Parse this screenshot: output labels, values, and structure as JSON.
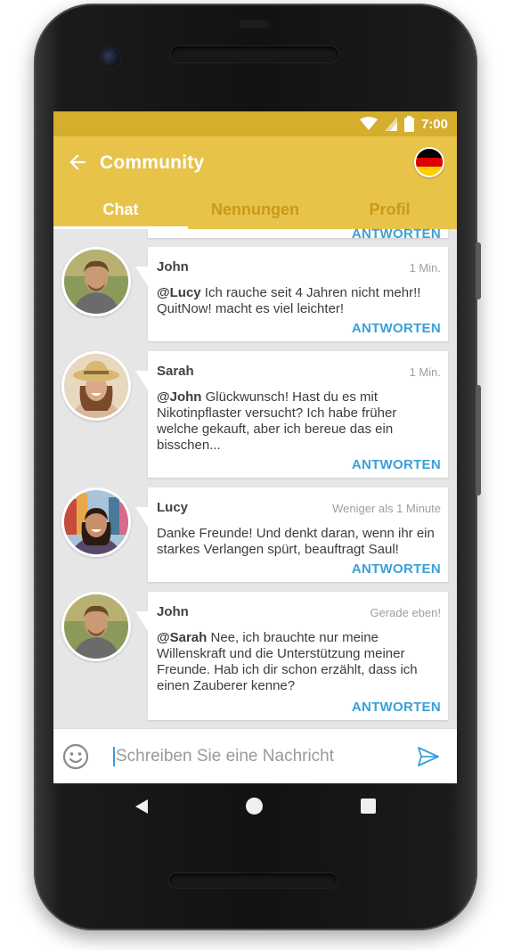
{
  "status_bar": {
    "time": "7:00"
  },
  "app_bar": {
    "title": "Community"
  },
  "tabs": [
    {
      "label": "Chat",
      "active": true
    },
    {
      "label": "Nennungen",
      "active": false
    },
    {
      "label": "Profil",
      "active": false
    }
  ],
  "partial_reply": "ANTWORTEN",
  "messages": [
    {
      "author": "John",
      "time": "1 Min.",
      "mention": "@Lucy",
      "text": " Ich rauche seit 4 Jahren nicht mehr!! QuitNow! macht es viel leichter!",
      "reply_label": "ANTWORTEN"
    },
    {
      "author": "Sarah",
      "time": "1 Min.",
      "mention": "@John",
      "text": " Glückwunsch! Hast du es mit Nikotinpflaster versucht? Ich habe früher welche gekauft, aber ich bereue das ein bisschen...",
      "reply_label": "ANTWORTEN"
    },
    {
      "author": "Lucy",
      "time": "Weniger als 1 Minute",
      "mention": "",
      "text": "Danke Freunde! Und denkt daran, wenn ihr ein starkes Verlangen spürt, beauftragt Saul!",
      "reply_label": "ANTWORTEN"
    },
    {
      "author": "John",
      "time": "Gerade eben!",
      "mention": "@Sarah",
      "text": " Nee, ich brauchte nur meine Willenskraft und die Unterstützung meiner Freunde. Hab ich dir schon erzählt, dass ich einen Zauberer kenne?",
      "reply_label": "ANTWORTEN"
    }
  ],
  "composer": {
    "placeholder": "Schreiben Sie eine Nachricht"
  },
  "colors": {
    "status_bar": "#d4ae2c",
    "app_bar": "#e8c34a",
    "tab_inactive": "#c89a18",
    "reply_link": "#3aa0d8",
    "flag_black": "#000000",
    "flag_red": "#dd0000",
    "flag_gold": "#ffce00"
  },
  "icons": {
    "back": "arrow-left-icon",
    "flag": "germany-flag-icon",
    "emoji": "smiley-icon",
    "send": "send-icon",
    "wifi": "wifi-icon",
    "signal": "signal-icon",
    "battery": "battery-icon"
  }
}
